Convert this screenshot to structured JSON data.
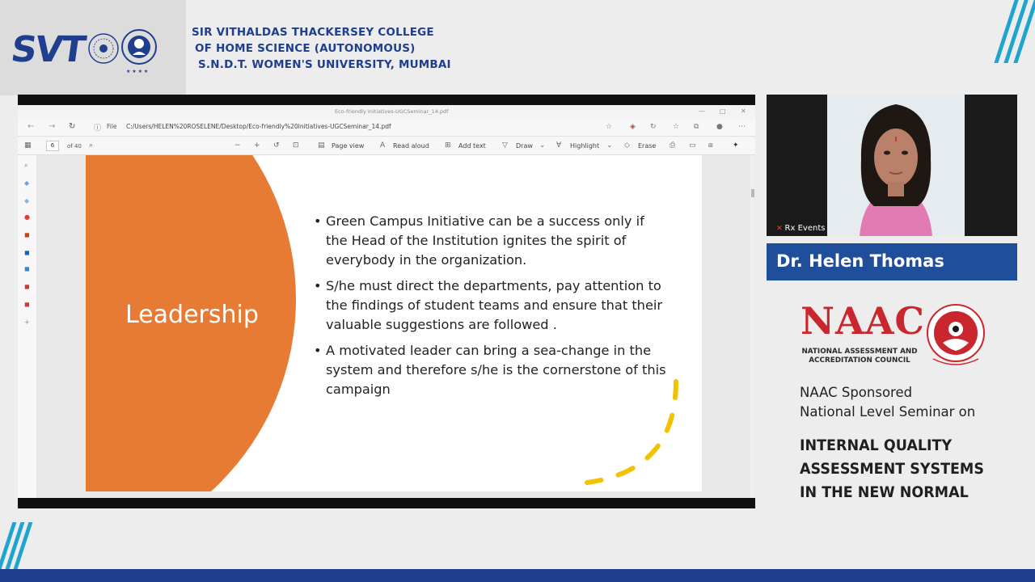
{
  "header": {
    "logo_text": "SVT",
    "college_lines": [
      "SIR VITHALDAS THACKERSEY COLLEGE",
      "OF HOME SCIENCE (AUTONOMOUS)",
      "S.N.D.T. WOMEN'S UNIVERSITY, MUMBAI"
    ]
  },
  "browser": {
    "tab_title": "Eco-friendly Initiatives-UGCSeminar_14.pdf",
    "url_prefix": "File",
    "url_path": "C:/Users/HELEN%20ROSELENE/Desktop/Eco-friendly%20Initiatives-UGCSeminar_14.pdf"
  },
  "pdf_toolbar": {
    "page_number": "6",
    "page_total": "of 40",
    "page_view": "Page view",
    "read_aloud": "Read aloud",
    "add_text": "Add text",
    "draw": "Draw",
    "highlight": "Highlight",
    "erase": "Erase"
  },
  "slide": {
    "title": "Leadership",
    "bullets": [
      "Green Campus Initiative can be a success only if the Head of the Institution ignites the spirit of everybody in the organization.",
      "S/he must direct the departments, pay attention to the findings of student teams and ensure that their valuable suggestions are followed .",
      "A motivated leader can bring a sea-change in the system and therefore s/he is the cornerstone of this campaign"
    ]
  },
  "speaker": {
    "tile_label": "Rx Events",
    "name": "Dr. Helen Thomas"
  },
  "naac": {
    "logo": "NAAC",
    "subtitle_lines": [
      "NATIONAL ASSESSMENT AND",
      "ACCREDITATION COUNCIL"
    ],
    "seminar_intro": [
      "NAAC Sponsored",
      "National Level Seminar on"
    ],
    "seminar_title": [
      "INTERNAL QUALITY",
      "ASSESSMENT SYSTEMS",
      "IN THE NEW NORMAL"
    ]
  },
  "colors": {
    "brand_blue": "#1f3f8e",
    "accent_cyan": "#1fa3cf",
    "slide_orange": "#e77b33",
    "name_bar": "#1f4e9a",
    "naac_red": "#c9262d"
  }
}
